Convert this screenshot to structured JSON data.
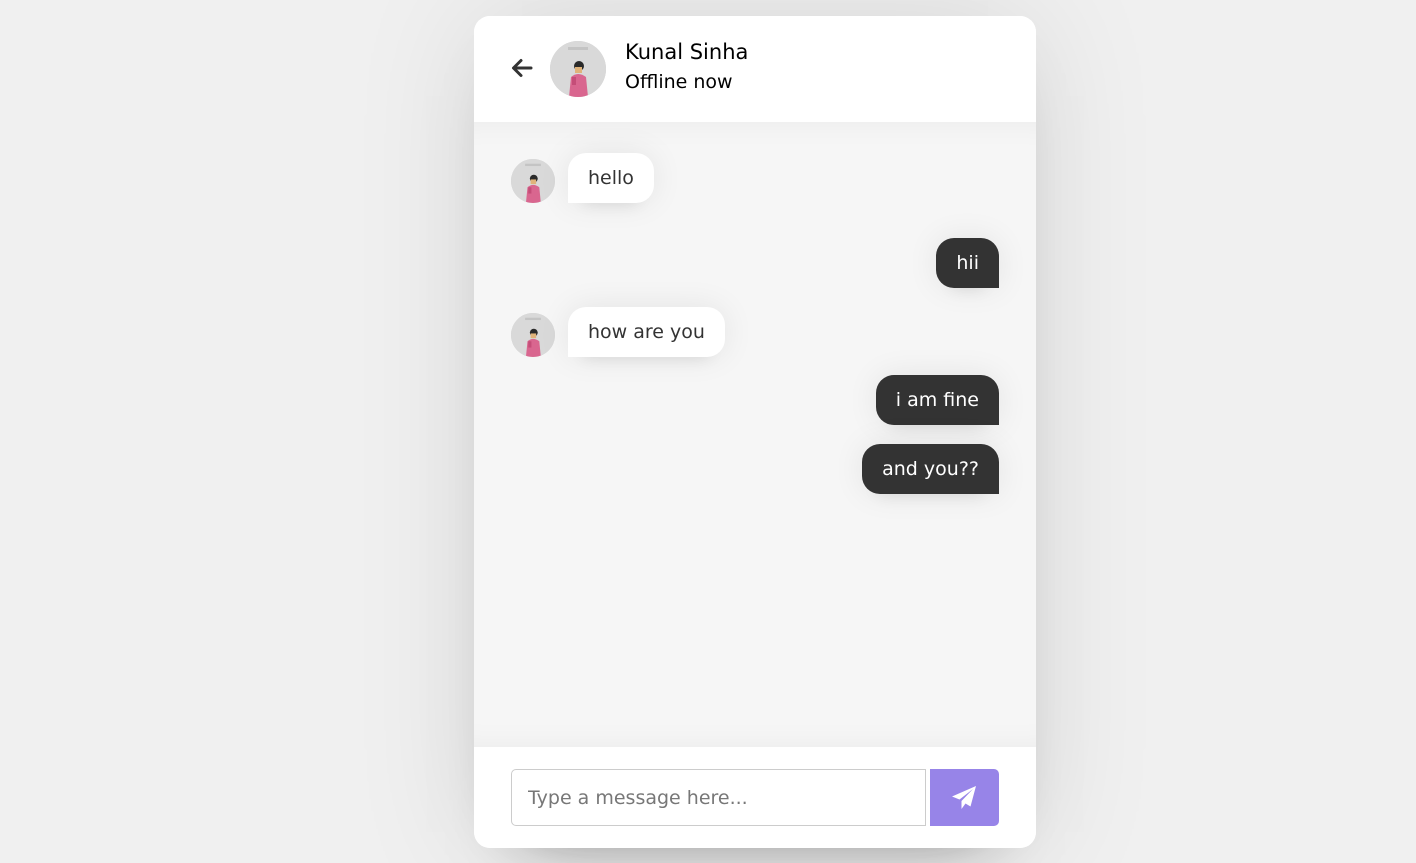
{
  "header": {
    "contact_name": "Kunal Sinha",
    "status": "Offline now",
    "back_icon": "arrow-left-icon",
    "avatar": "contact-avatar"
  },
  "messages": [
    {
      "direction": "incoming",
      "text": "hello"
    },
    {
      "direction": "outgoing",
      "text": "hii"
    },
    {
      "direction": "incoming",
      "text": "how are you"
    },
    {
      "direction": "outgoing",
      "text": "i am fine"
    },
    {
      "direction": "outgoing",
      "text": "and you??"
    }
  ],
  "composer": {
    "placeholder": "Type a message here...",
    "value": "",
    "send_icon": "paper-plane-icon"
  },
  "colors": {
    "page_background": "#f0f0f0",
    "chat_background": "#f6f6f6",
    "outgoing_bubble": "#333333",
    "incoming_bubble": "#ffffff",
    "send_button": "#9784e8"
  }
}
